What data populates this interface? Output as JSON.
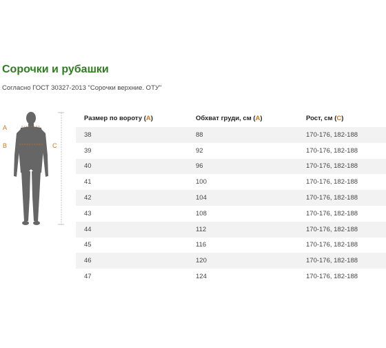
{
  "page": {
    "title": "Сорочки и рубашки",
    "subtitle": "Согласно ГОСТ 30327-2013 \"Сорочки верхние. ОТУ\""
  },
  "figure": {
    "marker_a": "A",
    "marker_b": "B",
    "marker_c": "C",
    "accent_color": "#c9781e",
    "body_color": "#666666"
  },
  "table": {
    "headers": [
      {
        "label": "Размер по вороту (",
        "letter": "A",
        "close": ")"
      },
      {
        "label": "Обхват груди, см (",
        "letter": "A",
        "close": ")"
      },
      {
        "label": "Рост, см (",
        "letter": "C",
        "close": ")"
      }
    ],
    "rows": [
      [
        "38",
        "88",
        "170-176, 182-188"
      ],
      [
        "39",
        "92",
        "170-176, 182-188"
      ],
      [
        "40",
        "96",
        "170-176, 182-188"
      ],
      [
        "41",
        "100",
        "170-176, 182-188"
      ],
      [
        "42",
        "104",
        "170-176, 182-188"
      ],
      [
        "43",
        "108",
        "170-176, 182-188"
      ],
      [
        "44",
        "112",
        "170-176, 182-188"
      ],
      [
        "45",
        "116",
        "170-176, 182-188"
      ],
      [
        "46",
        "120",
        "170-176, 182-188"
      ],
      [
        "47",
        "124",
        "170-176, 182-188"
      ]
    ]
  }
}
